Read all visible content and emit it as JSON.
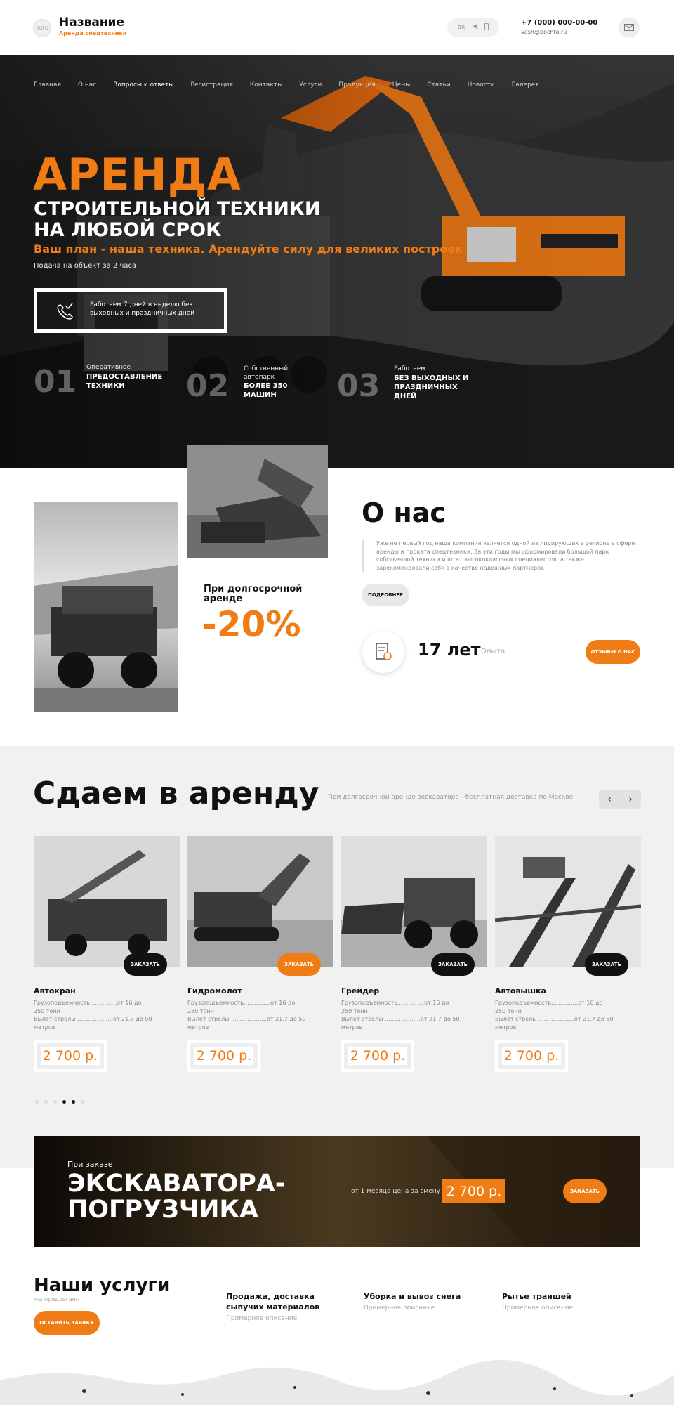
{
  "header": {
    "logo_text": "ЛОГО",
    "brand": "Название",
    "brand_sub": "Аренда спецтехники",
    "social": [
      "вк",
      "тг",
      "вб"
    ],
    "phone": "+7 (000) 000-00-00",
    "email": "Vash@pochta.ru"
  },
  "nav": [
    "Главная",
    "О нас",
    "Вопросы и ответы",
    "Регистрация",
    "Контакты",
    "Услуги",
    "Продукция",
    "Цены",
    "Статьи",
    "Новости",
    "Галерея"
  ],
  "hero": {
    "title_orange": "АРЕНДА",
    "title_white_1": "СТРОИТЕЛЬНОЙ ТЕХНИКИ",
    "title_white_2": "НА ЛЮБОЙ СРОК",
    "slogan": "Ваш план - наша техника. Арендуйте силу для великих построек",
    "note": "Подача на объект за 2 часа",
    "work_hours": "Работаем 7 дней в неделю без выходных и праздничных дней"
  },
  "stats": [
    {
      "num": "01",
      "small": "Оперативное",
      "big": "ПРЕДОСТАВЛЕНИЕ ТЕХНИКИ"
    },
    {
      "num": "02",
      "small": "Собственный автопарк",
      "big": "БОЛЕЕ 350 МАШИН"
    },
    {
      "num": "03",
      "small": "Работаем",
      "big": "БЕЗ ВЫХОДНЫХ И ПРАЗДНИЧНЫХ ДНЕЙ"
    }
  ],
  "about": {
    "title": "О нас",
    "text": "Уже не первый год наша компания является одной из лидирующих в регионе в сфере аренды и проката спецтехники. За эти годы мы сформировали большой парк собственной техники и штат высококлассных специалистов, а также зарекомендовали себя в качестве надежных партнеров",
    "more_button": "ПОДРОБНЕЕ",
    "years": "17 лет",
    "years_label": "Опыта",
    "reviews_button": "ОТЗЫВЫ О НАС",
    "discount_label": "При долгосрочной аренде",
    "discount": "-20%"
  },
  "rent": {
    "title": "Сдаем в аренду",
    "subtitle": "При долгосрочной аренде экскаватора - бесплатная доставка по Москве",
    "prev": "‹",
    "next": "›",
    "cards": [
      {
        "name": "Автокран",
        "spec1": "Грузоподъемность...............от 16 до 250 тонн",
        "spec2": "Вылет стрелы ....................от 21,7 до 50 метров",
        "price": "2 700 р.",
        "order": "ЗАКАЗАТЬ"
      },
      {
        "name": "Гидромолот",
        "spec1": "Грузоподъемность...............от 16 до 250 тонн",
        "spec2": "Вылет стрелы ....................от 21,7 до 50 метров",
        "price": "2 700 р.",
        "order": "ЗАКАЗАТЬ"
      },
      {
        "name": "Грейдер",
        "spec1": "Грузоподъемность...............от 16 до 250 тонн",
        "spec2": "Вылет стрелы ....................от 21,7 до 50 метров",
        "price": "2 700 р.",
        "order": "ЗАКАЗАТЬ"
      },
      {
        "name": "Автовышка",
        "spec1": "Грузоподъемность...............от 16 до 250 тонн",
        "spec2": "Вылет стрелы ....................от 21,7 до 50 метров",
        "price": "2 700 р.",
        "order": "ЗАКАЗАТЬ"
      }
    ]
  },
  "banner": {
    "pre": "При заказе",
    "title1": "ЭКСКАВАТОРА-",
    "title2": "ПОГРУЗЧИКА",
    "note": "от 1 месяца цена за смену",
    "price": "2 700 р.",
    "button": "ЗАКАЗАТЬ"
  },
  "services": {
    "title": "Наши услуги",
    "subtitle": "мы предлагаем",
    "button": "ОСТАВИТЬ ЗАЯВКУ",
    "items": [
      {
        "title": "Продажа, доставка сыпучих материалов",
        "desc": "Примерное описание"
      },
      {
        "title": "Уборка и вывоз снега",
        "desc": "Примерное описание"
      },
      {
        "title": "Рытье траншей",
        "desc": "Примерное описание"
      }
    ]
  },
  "colors": {
    "accent": "#f07c16",
    "dark": "#111111",
    "light_bg": "#f1f1f1"
  }
}
